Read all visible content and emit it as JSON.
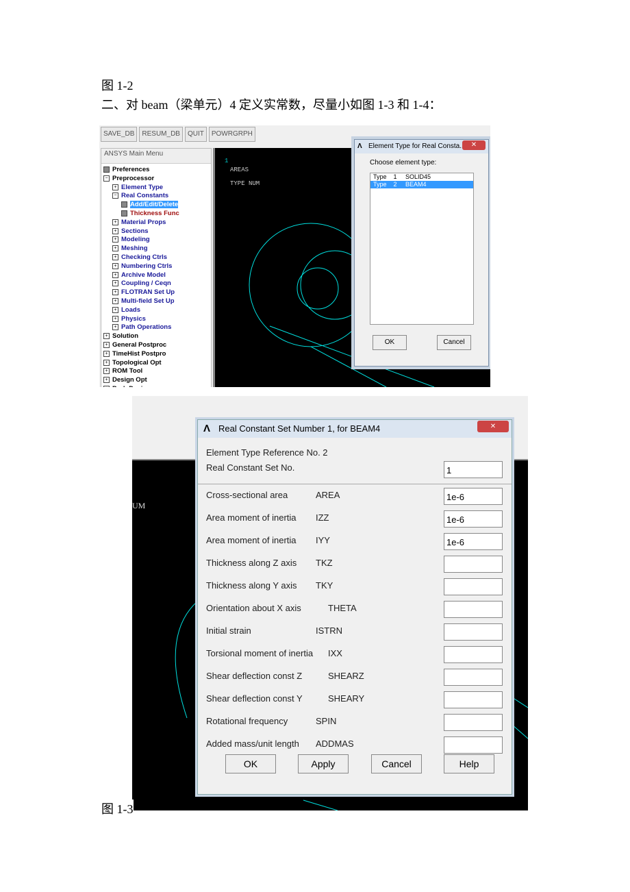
{
  "doc": {
    "caption_top": "图 1-2",
    "intro": "二、对 beam（梁单元）4 定义实常数，尽量小如图 1-3 和 1-4：",
    "caption_bottom": "图 1-3"
  },
  "shot1": {
    "toolbar": [
      "SAVE_DB",
      "RESUM_DB",
      "QUIT",
      "POWRGRPH"
    ],
    "menu_title": "ANSYS Main Menu",
    "menu": [
      {
        "label": "Preferences",
        "level": 0,
        "icon": "doc",
        "color": "black"
      },
      {
        "label": "Preprocessor",
        "level": 0,
        "icon": "minus",
        "color": "black"
      },
      {
        "label": "Element Type",
        "level": 1,
        "icon": "plus",
        "color": "blue"
      },
      {
        "label": "Real Constants",
        "level": 1,
        "icon": "minus",
        "color": "blue"
      },
      {
        "label": "Add/Edit/Delete",
        "level": 2,
        "icon": "doc",
        "color": "selected"
      },
      {
        "label": "Thickness Func",
        "level": 2,
        "icon": "doc",
        "color": "red"
      },
      {
        "label": "Material Props",
        "level": 1,
        "icon": "plus",
        "color": "blue"
      },
      {
        "label": "Sections",
        "level": 1,
        "icon": "plus",
        "color": "blue"
      },
      {
        "label": "Modeling",
        "level": 1,
        "icon": "plus",
        "color": "blue"
      },
      {
        "label": "Meshing",
        "level": 1,
        "icon": "plus",
        "color": "blue"
      },
      {
        "label": "Checking Ctrls",
        "level": 1,
        "icon": "plus",
        "color": "blue"
      },
      {
        "label": "Numbering Ctrls",
        "level": 1,
        "icon": "plus",
        "color": "blue"
      },
      {
        "label": "Archive Model",
        "level": 1,
        "icon": "plus",
        "color": "blue"
      },
      {
        "label": "Coupling / Ceqn",
        "level": 1,
        "icon": "plus",
        "color": "blue"
      },
      {
        "label": "FLOTRAN Set Up",
        "level": 1,
        "icon": "plus",
        "color": "blue"
      },
      {
        "label": "Multi-field Set Up",
        "level": 1,
        "icon": "plus",
        "color": "blue"
      },
      {
        "label": "Loads",
        "level": 1,
        "icon": "plus",
        "color": "blue"
      },
      {
        "label": "Physics",
        "level": 1,
        "icon": "plus",
        "color": "blue"
      },
      {
        "label": "Path Operations",
        "level": 1,
        "icon": "plus",
        "color": "blue"
      },
      {
        "label": "Solution",
        "level": 0,
        "icon": "plus",
        "color": "black"
      },
      {
        "label": "General Postproc",
        "level": 0,
        "icon": "plus",
        "color": "black"
      },
      {
        "label": "TimeHist Postpro",
        "level": 0,
        "icon": "plus",
        "color": "black"
      },
      {
        "label": "Topological Opt",
        "level": 0,
        "icon": "plus",
        "color": "black"
      },
      {
        "label": "ROM Tool",
        "level": 0,
        "icon": "plus",
        "color": "black"
      },
      {
        "label": "Design Opt",
        "level": 0,
        "icon": "plus",
        "color": "black"
      },
      {
        "label": "Prob Design",
        "level": 0,
        "icon": "plus",
        "color": "black"
      }
    ],
    "graphics": {
      "window_num": "1",
      "line1": "AREAS",
      "line2": "TYPE NUM"
    },
    "dialog": {
      "title": "Element Type for Real Consta...",
      "prompt": "Choose element type:",
      "items": [
        {
          "text": "Type    1     SOLID45",
          "selected": false
        },
        {
          "text": "Type    2     BEAM4",
          "selected": true
        }
      ],
      "ok": "OK",
      "cancel": "Cancel"
    }
  },
  "shot2": {
    "bg_text": "UM",
    "dialog": {
      "title": "Real Constant Set Number 1, for BEAM4",
      "ref": "Element Type Reference No. 2",
      "set_label": "Real Constant Set No.",
      "set_value": "1",
      "fields": [
        {
          "label": "Cross-sectional area",
          "code": "AREA",
          "value": "1e-6"
        },
        {
          "label": "Area moment of inertia",
          "code": "IZZ",
          "value": "1e-6"
        },
        {
          "label": "Area moment of inertia",
          "code": "IYY",
          "value": "1e-6"
        },
        {
          "label": "Thickness along Z axis",
          "code": "TKZ",
          "value": ""
        },
        {
          "label": "Thickness along Y axis",
          "code": "TKY",
          "value": ""
        },
        {
          "label": "Orientation about X axis",
          "code": "THETA",
          "value": ""
        },
        {
          "label": "Initial strain",
          "code": "ISTRN",
          "value": ""
        },
        {
          "label": "Torsional moment of inertia",
          "code": "IXX",
          "value": ""
        },
        {
          "label": "Shear deflection const Z",
          "code": "SHEARZ",
          "value": ""
        },
        {
          "label": "Shear deflection const Y",
          "code": "SHEARY",
          "value": ""
        },
        {
          "label": "Rotational frequency",
          "code": "SPIN",
          "value": ""
        },
        {
          "label": "Added mass/unit length",
          "code": "ADDMAS",
          "value": ""
        }
      ],
      "buttons": [
        "OK",
        "Apply",
        "Cancel",
        "Help"
      ]
    }
  },
  "colors": {
    "selection": "#3399ff",
    "graphics_bg": "#000000",
    "mesh_lines": "#00e0e0"
  }
}
